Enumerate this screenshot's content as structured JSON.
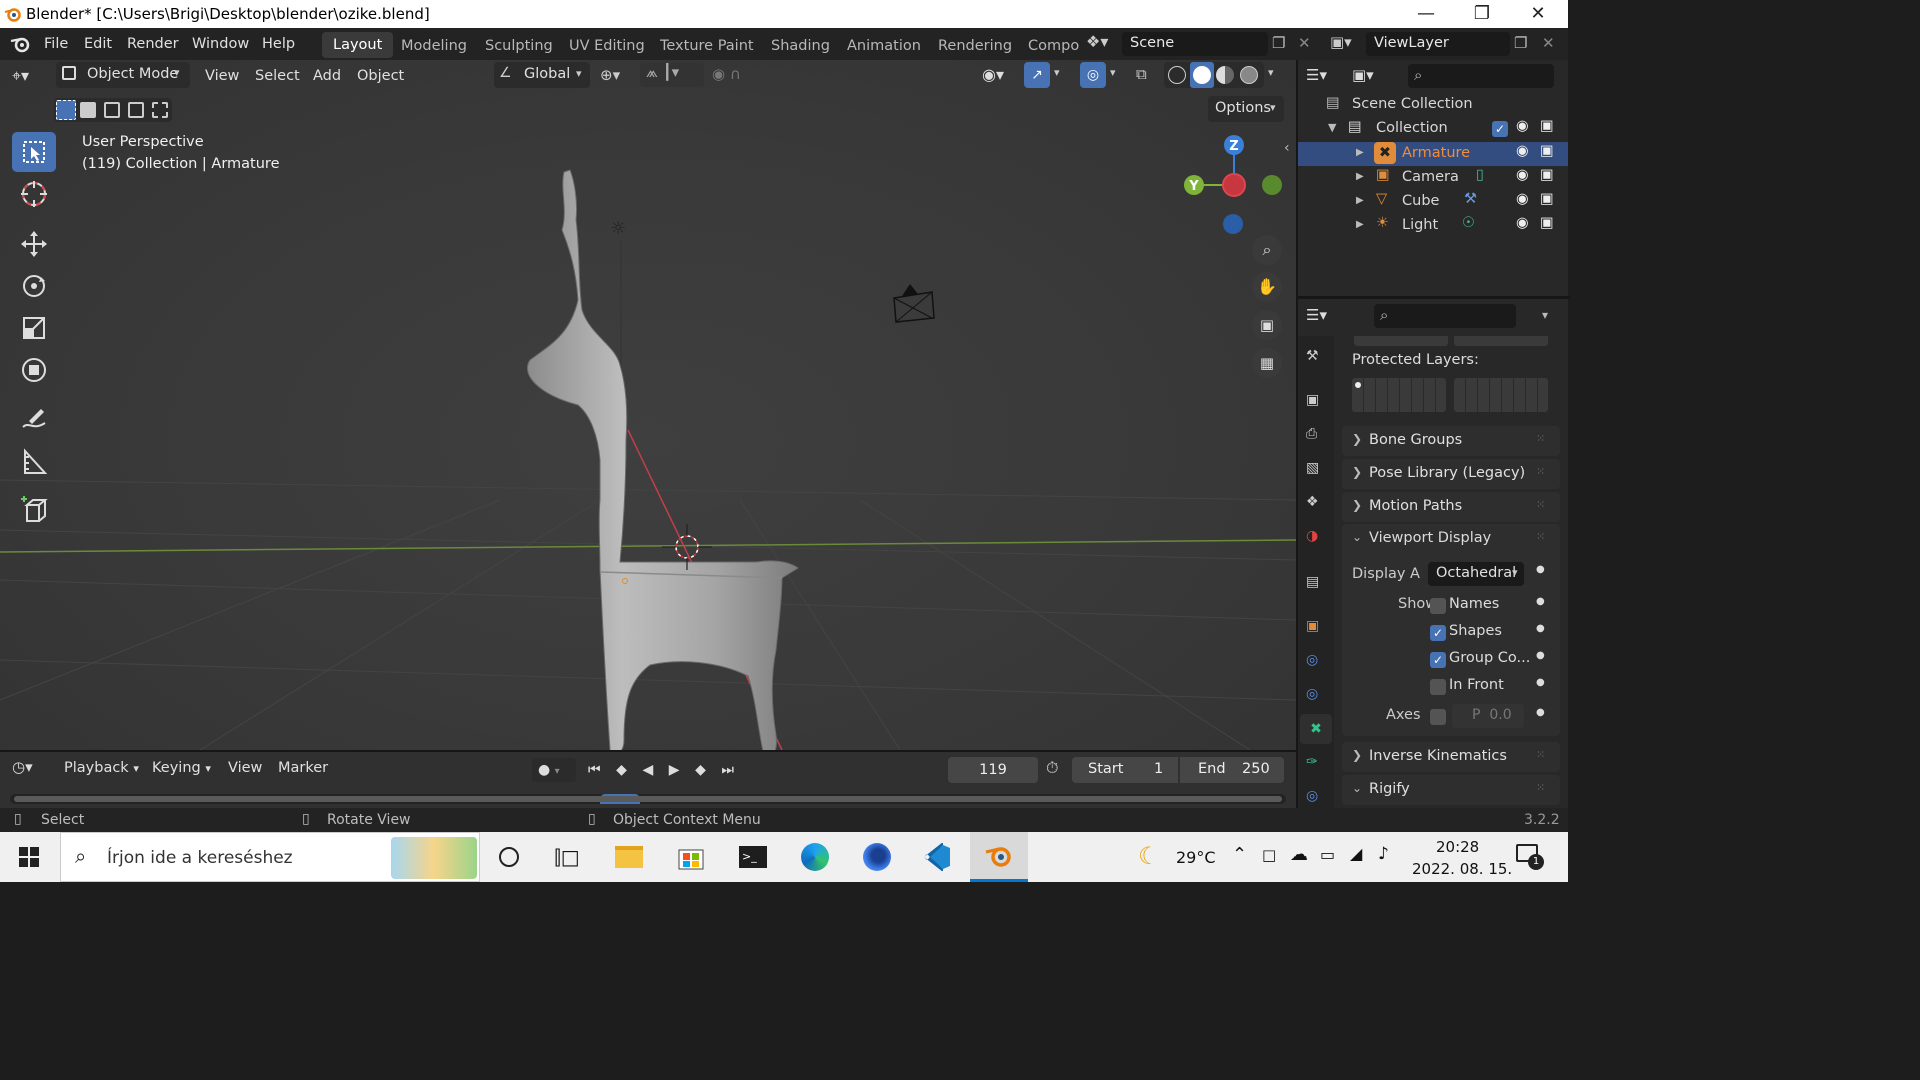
{
  "window": {
    "title": "Blender* [C:\\Users\\Brigi\\Desktop\\blender\\ozike.blend]",
    "controls": [
      "minimize-icon",
      "restore-icon",
      "close-icon"
    ]
  },
  "topmenu": {
    "items": [
      "File",
      "Edit",
      "Render",
      "Window",
      "Help"
    ],
    "workspaces": [
      "Layout",
      "Modeling",
      "Sculpting",
      "UV Editing",
      "Texture Paint",
      "Shading",
      "Animation",
      "Rendering",
      "Compo"
    ],
    "active_workspace": "Layout",
    "scene": "Scene",
    "view_layer": "ViewLayer"
  },
  "viewport": {
    "mode": "Object Mode",
    "menu": [
      "View",
      "Select",
      "Add",
      "Object"
    ],
    "orientation": "Global",
    "options_label": "Options",
    "perspective": "User Perspective",
    "context": "(119) Collection | Armature",
    "gizmo_axes": [
      "Z",
      "Y"
    ]
  },
  "outliner": {
    "root": "Scene Collection",
    "collection": "Collection",
    "items": [
      {
        "name": "Armature",
        "selected": true,
        "color": "#f08c3c"
      },
      {
        "name": "Camera",
        "selected": false
      },
      {
        "name": "Cube",
        "selected": false
      },
      {
        "name": "Light",
        "selected": false
      }
    ]
  },
  "properties": {
    "protected_layers_label": "Protected Layers:",
    "sections": [
      "Bone Groups",
      "Pose Library (Legacy)",
      "Motion Paths",
      "Viewport Display",
      "Inverse Kinematics",
      "Rigify"
    ],
    "display_as_label": "Display A",
    "display_as_value": "Octahedral",
    "show_label": "Show",
    "show_options": [
      {
        "label": "Names",
        "checked": false
      },
      {
        "label": "Shapes",
        "checked": true
      },
      {
        "label": "Group Co...",
        "checked": true
      },
      {
        "label": "In Front",
        "checked": false
      }
    ],
    "axes_label": "Axes",
    "axes_value": "P  0.0"
  },
  "timeline": {
    "menu": [
      "Playback",
      "Keying",
      "View",
      "Marker"
    ],
    "current_frame": "119",
    "start_label": "Start",
    "start_value": "1",
    "end_label": "End",
    "end_value": "250"
  },
  "statusbar": {
    "hints": [
      "Select",
      "Rotate View",
      "Object Context Menu"
    ],
    "version": "3.2.2"
  },
  "taskbar": {
    "search_placeholder": "Írjon ide a kereséshez",
    "weather": "29°C",
    "time": "20:28",
    "date": "2022. 08. 15.",
    "notification_count": "1"
  },
  "colors": {
    "accent": "#4772b3",
    "selected_object": "#f08c3c",
    "x_axis": "#e0454f",
    "y_axis": "#7fb33a",
    "z_axis": "#3a7fd8"
  }
}
